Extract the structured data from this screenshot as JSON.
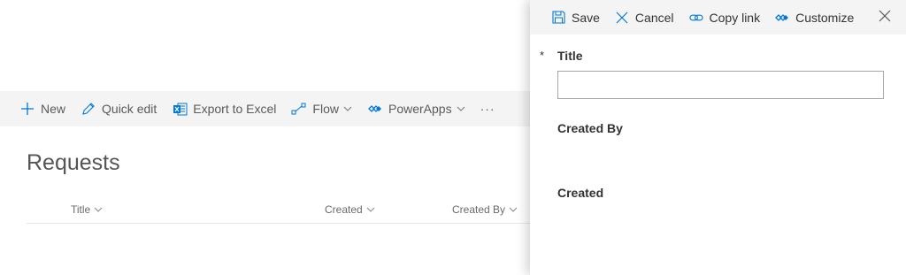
{
  "command_bar": {
    "items": [
      {
        "label": "New",
        "icon": "plus-icon"
      },
      {
        "label": "Quick edit",
        "icon": "pencil-icon"
      },
      {
        "label": "Export to Excel",
        "icon": "excel-icon"
      },
      {
        "label": "Flow",
        "icon": "flow-icon",
        "has_dropdown": true
      },
      {
        "label": "PowerApps",
        "icon": "powerapps-icon",
        "has_dropdown": true
      }
    ],
    "more_label": "···"
  },
  "list": {
    "title": "Requests",
    "columns": [
      "Title",
      "Created",
      "Created By"
    ]
  },
  "panel": {
    "toolbar": {
      "save_label": "Save",
      "cancel_label": "Cancel",
      "copy_link_label": "Copy link",
      "customize_label": "Customize"
    },
    "required_marker": "*",
    "fields": {
      "title_label": "Title",
      "title_value": "",
      "created_by_label": "Created By",
      "created_label": "Created"
    }
  },
  "colors": {
    "accent": "#0078d4",
    "command_bar_bg": "#f4f4f4",
    "text": "#333333"
  }
}
